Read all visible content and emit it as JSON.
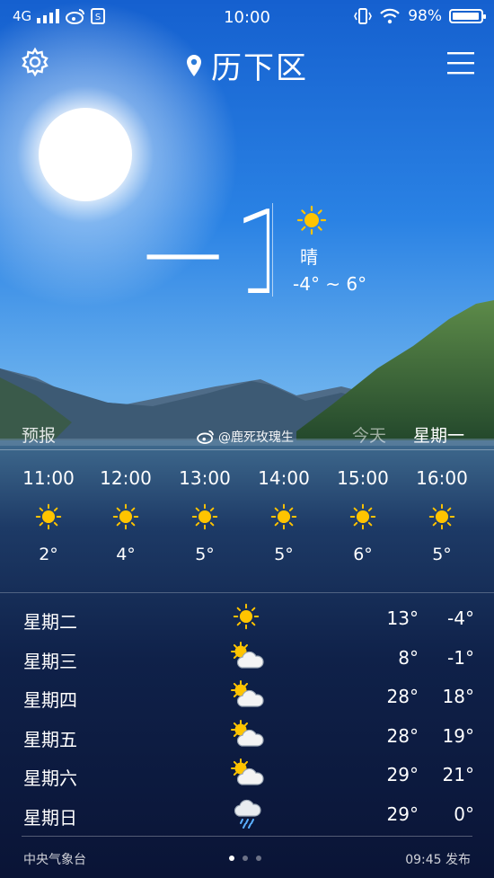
{
  "status_bar": {
    "network": "4G",
    "time": "10:00",
    "battery": "98%",
    "battery_level": 0.98
  },
  "header": {
    "city": "历下区",
    "location_icon": "location-pin-icon",
    "settings_icon": "gear-icon",
    "menu_icon": "menu-icon"
  },
  "current": {
    "temperature": "−1°",
    "condition": "晴",
    "range": "-4° ~ 6°",
    "icon": "sun-icon"
  },
  "forecast_header": {
    "label": "预报",
    "today": "今天",
    "weekday": "星期一",
    "watermark": "@鹿死玫瑰生"
  },
  "hourly": [
    {
      "time": "11:00",
      "temp": "2°",
      "icon": "sun-icon"
    },
    {
      "time": "12:00",
      "temp": "4°",
      "icon": "sun-icon"
    },
    {
      "time": "13:00",
      "temp": "5°",
      "icon": "sun-icon"
    },
    {
      "time": "14:00",
      "temp": "5°",
      "icon": "sun-icon"
    },
    {
      "time": "15:00",
      "temp": "6°",
      "icon": "sun-icon"
    },
    {
      "time": "16:00",
      "temp": "5°",
      "icon": "sun-icon"
    }
  ],
  "daily": [
    {
      "day": "星期二",
      "icon": "sun-icon",
      "high": "13°",
      "low": "-4°"
    },
    {
      "day": "星期三",
      "icon": "partly-cloudy-icon",
      "high": "8°",
      "low": "-1°"
    },
    {
      "day": "星期四",
      "icon": "partly-cloudy-icon",
      "high": "28°",
      "low": "18°"
    },
    {
      "day": "星期五",
      "icon": "partly-cloudy-icon",
      "high": "28°",
      "low": "19°"
    },
    {
      "day": "星期六",
      "icon": "partly-cloudy-icon",
      "high": "29°",
      "low": "21°"
    },
    {
      "day": "星期日",
      "icon": "rain-icon",
      "high": "29°",
      "low": "0°"
    }
  ],
  "footer": {
    "source": "中央气象台",
    "published": "09:45 发布",
    "page_count": 3,
    "active_page": 1
  },
  "colors": {
    "sky_top": "#1565d0",
    "sky_mid": "#2e86e6",
    "sun": "#ffc400",
    "night_bottom": "#0a1436"
  }
}
